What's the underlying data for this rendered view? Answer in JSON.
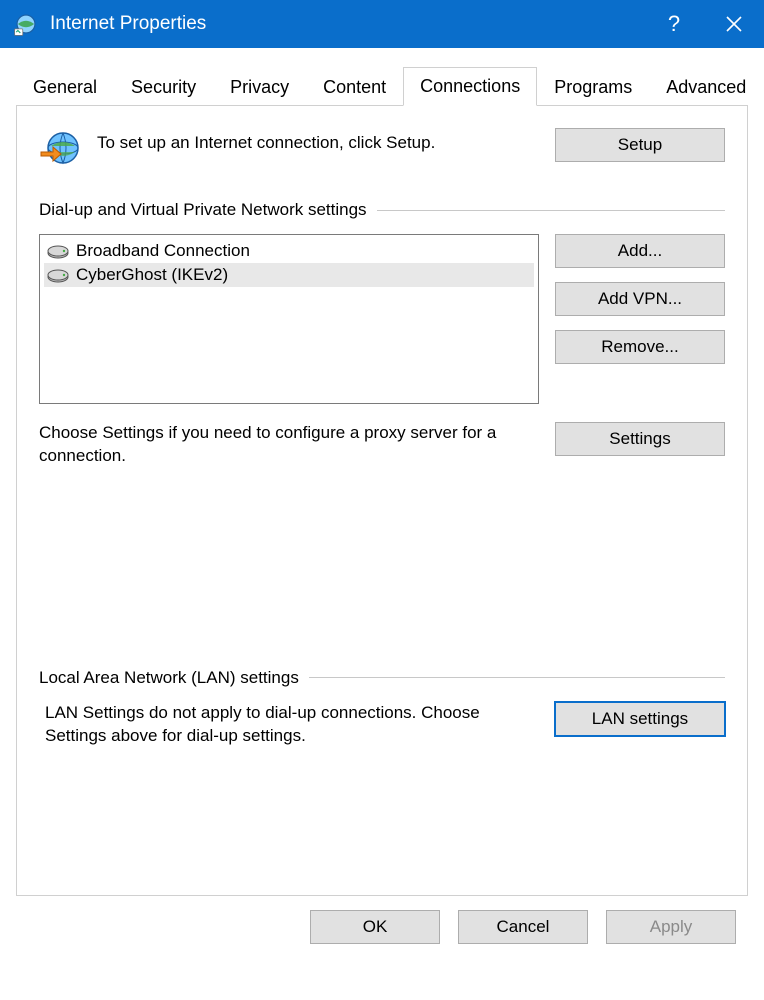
{
  "titlebar": {
    "title": "Internet Properties"
  },
  "tabs": {
    "general": "General",
    "security": "Security",
    "privacy": "Privacy",
    "content": "Content",
    "connections": "Connections",
    "programs": "Programs",
    "advanced": "Advanced"
  },
  "setup": {
    "text": "To set up an Internet connection, click Setup.",
    "button": "Setup"
  },
  "dialup": {
    "heading": "Dial-up and Virtual Private Network settings",
    "items": [
      {
        "label": "Broadband Connection"
      },
      {
        "label": "CyberGhost (IKEv2)"
      }
    ],
    "buttons": {
      "add": "Add...",
      "addvpn": "Add VPN...",
      "remove": "Remove...",
      "settings": "Settings"
    },
    "proxy_text": "Choose Settings if you need to configure a proxy server for a connection."
  },
  "lan": {
    "heading": "Local Area Network (LAN) settings",
    "text": "LAN Settings do not apply to dial-up connections. Choose Settings above for dial-up settings.",
    "button": "LAN settings"
  },
  "footer": {
    "ok": "OK",
    "cancel": "Cancel",
    "apply": "Apply"
  }
}
